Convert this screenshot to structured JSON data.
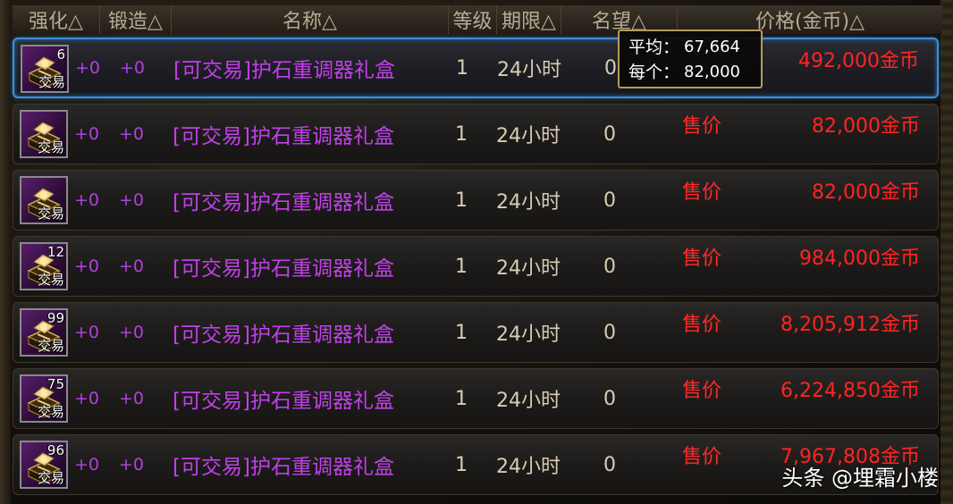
{
  "header": {
    "strengthen": "强化△",
    "forge": "锻造△",
    "name": "名称△",
    "level": "等级",
    "period": "期限△",
    "reputation": "名望△",
    "price": "价格(金币)△"
  },
  "tooltip": {
    "avg_label": "平均：",
    "avg_value": "67,664",
    "each_label": "每个：",
    "each_value": "82,000"
  },
  "rows": [
    {
      "count": "6",
      "trade": "交易",
      "strengthen": "+0",
      "forge": "+0",
      "name": "[可交易]护石重调器礼盒",
      "level": "1",
      "period": "24小时",
      "reputation": "0",
      "sale_label": "",
      "price": "492,000金币",
      "selected": true
    },
    {
      "count": "",
      "trade": "交易",
      "strengthen": "+0",
      "forge": "+0",
      "name": "[可交易]护石重调器礼盒",
      "level": "1",
      "period": "24小时",
      "reputation": "0",
      "sale_label": "售价",
      "price": "82,000金币",
      "selected": false
    },
    {
      "count": "",
      "trade": "交易",
      "strengthen": "+0",
      "forge": "+0",
      "name": "[可交易]护石重调器礼盒",
      "level": "1",
      "period": "24小时",
      "reputation": "0",
      "sale_label": "售价",
      "price": "82,000金币",
      "selected": false
    },
    {
      "count": "12",
      "trade": "交易",
      "strengthen": "+0",
      "forge": "+0",
      "name": "[可交易]护石重调器礼盒",
      "level": "1",
      "period": "24小时",
      "reputation": "0",
      "sale_label": "售价",
      "price": "984,000金币",
      "selected": false
    },
    {
      "count": "99",
      "trade": "交易",
      "strengthen": "+0",
      "forge": "+0",
      "name": "[可交易]护石重调器礼盒",
      "level": "1",
      "period": "24小时",
      "reputation": "0",
      "sale_label": "售价",
      "price": "8,205,912金币",
      "selected": false
    },
    {
      "count": "75",
      "trade": "交易",
      "strengthen": "+0",
      "forge": "+0",
      "name": "[可交易]护石重调器礼盒",
      "level": "1",
      "period": "24小时",
      "reputation": "0",
      "sale_label": "售价",
      "price": "6,224,850金币",
      "selected": false
    },
    {
      "count": "96",
      "trade": "交易",
      "strengthen": "+0",
      "forge": "+0",
      "name": "[可交易]护石重调器礼盒",
      "level": "1",
      "period": "24小时",
      "reputation": "0",
      "sale_label": "售价",
      "price": "7,967,808金币",
      "selected": false
    }
  ],
  "watermark": "头条 @埋霜小楼",
  "colors": {
    "item_name": "#c040ea",
    "price": "#ff2424",
    "selection_border": "#3d8fd6",
    "tooltip_border": "#b59b5a"
  },
  "icons": {
    "item": "gift-box-icon"
  }
}
